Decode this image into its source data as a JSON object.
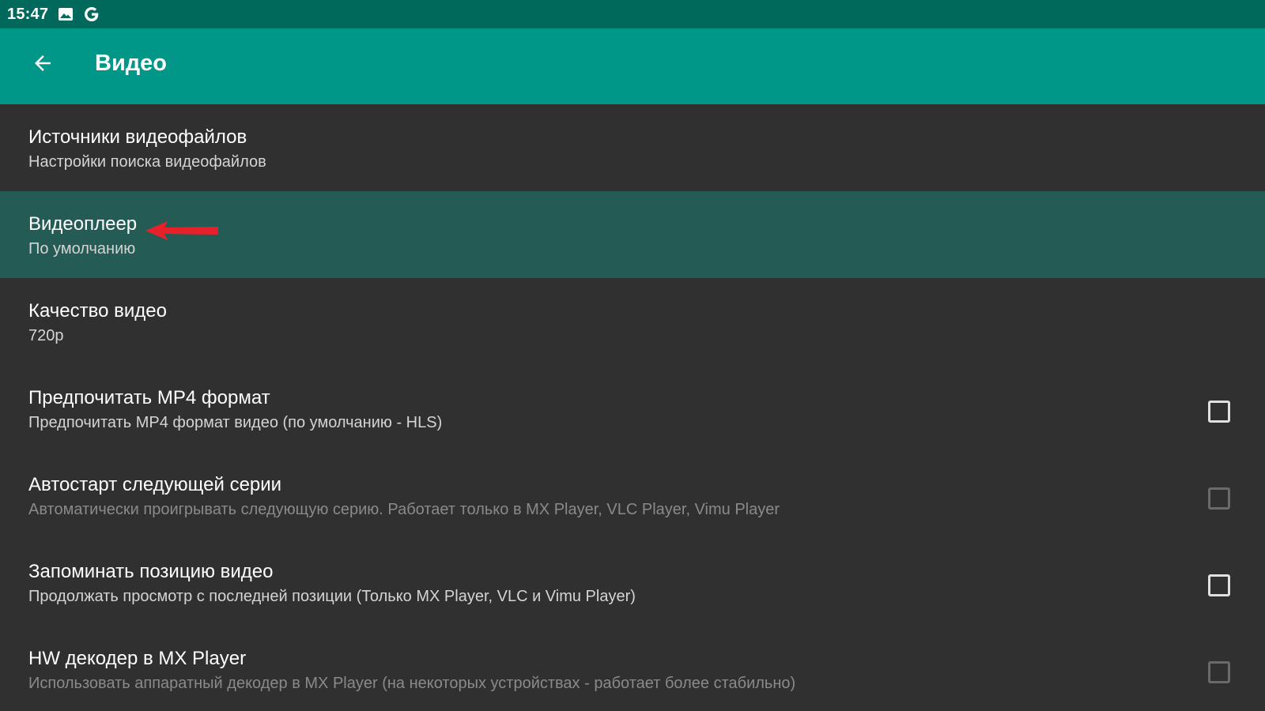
{
  "status_bar": {
    "time": "15:47",
    "icons": [
      "image-icon",
      "google-icon"
    ]
  },
  "toolbar": {
    "back_icon": "arrow-left-icon",
    "title": "Видео"
  },
  "preferences": [
    {
      "title": "Источники видеофайлов",
      "summary": "Настройки поиска видеофайлов"
    },
    {
      "title": "Видеоплеер",
      "summary": "По умолчанию",
      "selected": true,
      "annotation": "red-arrow-icon"
    },
    {
      "title": "Качество видео",
      "summary": "720p"
    },
    {
      "title": "Предпочитать MP4 формат",
      "summary": "Предпочитать MP4 формат видео (по умолчанию - HLS)",
      "checkbox": false
    },
    {
      "title": "Автостарт следующей серии",
      "summary": "Автоматически проигрывать следующую серию. Работает только в MX Player, VLC Player, Vimu Player",
      "checkbox": false,
      "disabled": true
    },
    {
      "title": "Запоминать позицию видео",
      "summary": "Продолжать просмотр с последней позиции (Только MX Player, VLC и Vimu Player)",
      "checkbox": false
    },
    {
      "title": "HW декодер в MX Player",
      "summary": "Использовать аппаратный декодер в MX Player (на некоторых устройствах - работает более стабильно)",
      "checkbox": false,
      "disabled": true
    }
  ],
  "colors": {
    "status_bar": "#00695c",
    "toolbar": "#009688",
    "background": "#303030",
    "selected_row": "#245c55",
    "annotation_arrow": "#e8202a"
  }
}
